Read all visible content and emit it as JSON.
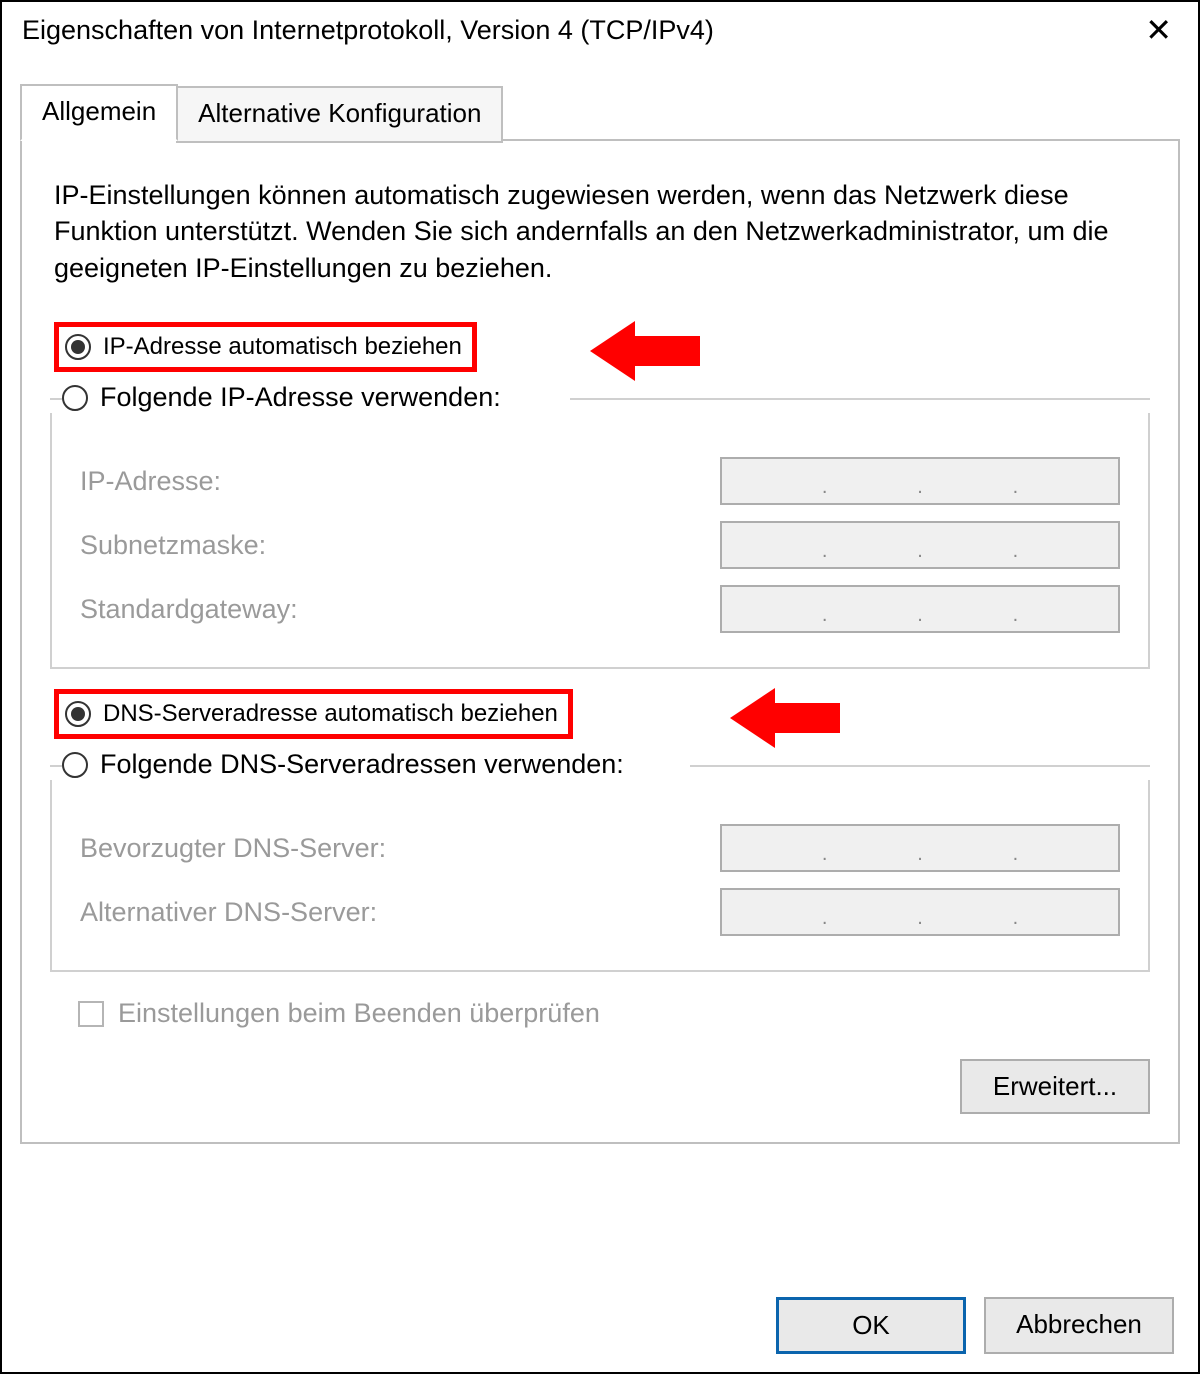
{
  "window": {
    "title": "Eigenschaften von Internetprotokoll, Version 4 (TCP/IPv4)"
  },
  "tabs": {
    "general": "Allgemein",
    "alternate": "Alternative Konfiguration"
  },
  "description": "IP-Einstellungen können automatisch zugewiesen werden, wenn das Netzwerk diese Funktion unterstützt. Wenden Sie sich andernfalls an den Netzwerkadministrator, um die geeigneten IP-Einstellungen zu beziehen.",
  "ip": {
    "auto_label": "IP-Adresse automatisch beziehen",
    "manual_label": "Folgende IP-Adresse verwenden:",
    "field_ip": "IP-Adresse:",
    "field_subnet": "Subnetzmaske:",
    "field_gateway": "Standardgateway:"
  },
  "dns": {
    "auto_label": "DNS-Serveradresse automatisch beziehen",
    "manual_label": "Folgende DNS-Serveradressen verwenden:",
    "field_preferred": "Bevorzugter DNS-Server:",
    "field_alternate": "Alternativer DNS-Server:"
  },
  "validate_label": "Einstellungen beim Beenden überprüfen",
  "buttons": {
    "advanced": "Erweitert...",
    "ok": "OK",
    "cancel": "Abbrechen"
  }
}
